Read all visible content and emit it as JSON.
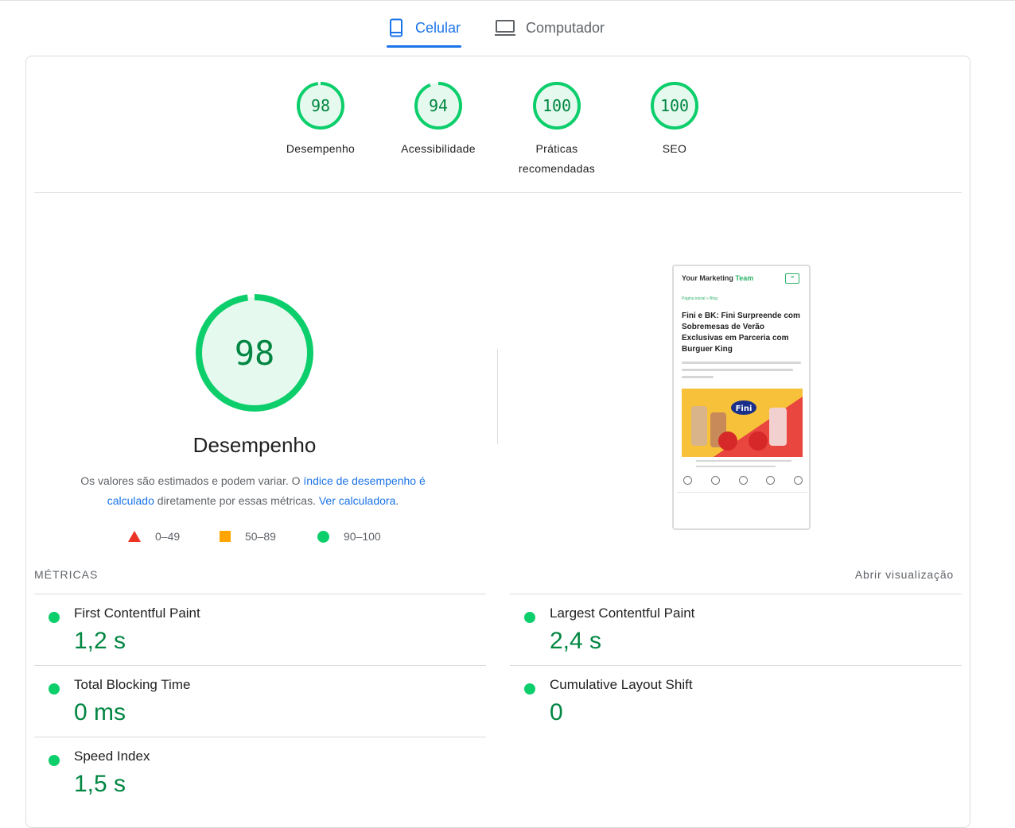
{
  "tabs": {
    "mobile": {
      "label": "Celular"
    },
    "desktop": {
      "label": "Computador"
    }
  },
  "categories": [
    {
      "score": "98",
      "label": "Desempenho"
    },
    {
      "score": "94",
      "label": "Acessibilidade"
    },
    {
      "score": "100",
      "label": "Práticas",
      "label2": "recomendadas"
    },
    {
      "score": "100",
      "label": "SEO"
    }
  ],
  "performance": {
    "score": "98",
    "title": "Desempenho",
    "desc_pre": "Os valores são estimados e podem variar. O ",
    "desc_link": "índice de desempenho é calculado",
    "desc_mid": " diretamente por essas métricas. ",
    "desc_link2": "Ver calculadora",
    "desc_end": "."
  },
  "legend": {
    "fail": "0–49",
    "average": "50–89",
    "pass": "90–100"
  },
  "screenshot": {
    "site_name": "Your Marketing",
    "site_name_accent": "Team",
    "breadcrumb": "Página inicial » Blog",
    "article_title": "Fini e BK: Fini Surpreende com Sobremesas de Verão Exclusivas em Parceria com Burguer King",
    "image_brand": "Fini"
  },
  "metrics": {
    "heading": "MÉTRICAS",
    "toggle": "Abrir visualização",
    "items": [
      {
        "name": "First Contentful Paint",
        "value": "1,2 s"
      },
      {
        "name": "Largest Contentful Paint",
        "value": "2,4 s"
      },
      {
        "name": "Total Blocking Time",
        "value": "0 ms"
      },
      {
        "name": "Cumulative Layout Shift",
        "value": "0"
      },
      {
        "name": "Speed Index",
        "value": "1,5 s"
      }
    ]
  },
  "colors": {
    "pass": "#0cce6b",
    "pass_text": "#008800",
    "average": "#ffa400",
    "fail": "#eb3223",
    "accent": "#1a73e8"
  },
  "icons": {
    "mobile_tab": "smartphone-icon",
    "desktop_tab": "laptop-icon"
  }
}
